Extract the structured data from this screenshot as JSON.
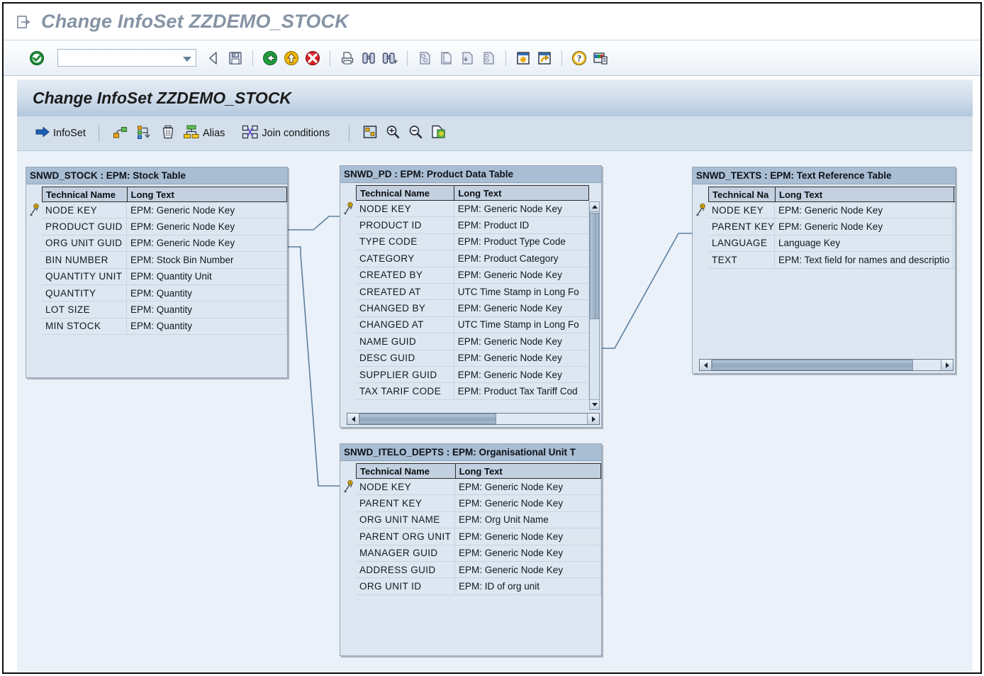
{
  "window": {
    "title": "Change InfoSet ZZDEMO_STOCK",
    "title_icon": "exit-arrow-icon"
  },
  "system_toolbar": {
    "enter_icon": "enter-check-icon",
    "command_field": {
      "value": "",
      "placeholder": ""
    },
    "buttons": [
      {
        "name": "back-triangle-button",
        "icon": "back-triangle-icon"
      },
      {
        "name": "save-button",
        "icon": "save-disk-icon"
      },
      {
        "name": "back-button",
        "icon": "green-back-arrow-icon"
      },
      {
        "name": "exit-button",
        "icon": "yellow-exit-arrow-icon"
      },
      {
        "name": "cancel-button",
        "icon": "red-cancel-icon"
      },
      {
        "name": "print-button",
        "icon": "printer-icon"
      },
      {
        "name": "find-button",
        "icon": "binoculars-icon"
      },
      {
        "name": "find-next-button",
        "icon": "binoculars-plus-icon"
      },
      {
        "name": "first-page-button",
        "icon": "first-page-icon"
      },
      {
        "name": "previous-page-button",
        "icon": "previous-page-icon"
      },
      {
        "name": "next-page-button",
        "icon": "next-page-icon"
      },
      {
        "name": "last-page-button",
        "icon": "last-page-icon"
      },
      {
        "name": "new-session-button",
        "icon": "new-session-icon"
      },
      {
        "name": "create-shortcut-button",
        "icon": "shortcut-arrow-icon"
      },
      {
        "name": "help-button",
        "icon": "help-question-icon"
      },
      {
        "name": "customize-layout-button",
        "icon": "layout-menu-icon"
      }
    ]
  },
  "screen": {
    "title": "Change InfoSet ZZDEMO_STOCK"
  },
  "app_toolbar": {
    "items": [
      {
        "name": "infoset-button",
        "label": "InfoSet",
        "icon": "blue-right-arrow-icon"
      },
      {
        "name": "insert-table-button",
        "label": "",
        "icon": "insert-node-icon"
      },
      {
        "name": "arrange-button",
        "label": "",
        "icon": "arrange-nodes-icon"
      },
      {
        "name": "delete-button",
        "label": "",
        "icon": "trash-can-icon"
      },
      {
        "name": "alias-button",
        "label": "Alias",
        "icon": "alias-hierarchy-icon"
      },
      {
        "name": "join-conditions-button",
        "label": "Join conditions",
        "icon": "join-links-icon"
      },
      {
        "name": "overview-button",
        "label": "",
        "icon": "overview-map-icon"
      },
      {
        "name": "zoom-in-button",
        "label": "",
        "icon": "zoom-in-magnifier-icon"
      },
      {
        "name": "zoom-out-button",
        "label": "",
        "icon": "zoom-out-magnifier-icon"
      },
      {
        "name": "export-button",
        "label": "",
        "icon": "export-page-icon"
      }
    ]
  },
  "diagram": {
    "column_headers": {
      "technical_name": "Technical Name",
      "long_text": "Long Text"
    },
    "column_headers_truncated": {
      "technical_name": "Technical Na",
      "long_text": "Long Text"
    },
    "tables": [
      {
        "id": "snwd_stock",
        "title": "SNWD_STOCK : EPM: Stock Table",
        "key_row_index": 0,
        "rows": [
          {
            "technical_name": "NODE KEY",
            "long_text": "EPM: Generic Node Key"
          },
          {
            "technical_name": "PRODUCT GUID",
            "long_text": "EPM: Generic Node Key"
          },
          {
            "technical_name": "ORG UNIT GUID",
            "long_text": "EPM: Generic Node Key"
          },
          {
            "technical_name": "BIN NUMBER",
            "long_text": "EPM: Stock Bin Number"
          },
          {
            "technical_name": "QUANTITY UNIT",
            "long_text": "EPM: Quantity Unit"
          },
          {
            "technical_name": "QUANTITY",
            "long_text": "EPM: Quantity"
          },
          {
            "technical_name": "LOT SIZE",
            "long_text": "EPM: Quantity"
          },
          {
            "technical_name": "MIN STOCK",
            "long_text": "EPM: Quantity"
          }
        ]
      },
      {
        "id": "snwd_pd",
        "title": "SNWD_PD : EPM: Product Data Table",
        "key_row_index": 0,
        "rows": [
          {
            "technical_name": "NODE KEY",
            "long_text": "EPM: Generic Node Key"
          },
          {
            "technical_name": "PRODUCT ID",
            "long_text": "EPM: Product ID"
          },
          {
            "technical_name": "TYPE CODE",
            "long_text": "EPM: Product Type Code"
          },
          {
            "technical_name": "CATEGORY",
            "long_text": "EPM: Product Category"
          },
          {
            "technical_name": "CREATED BY",
            "long_text": "EPM: Generic Node Key"
          },
          {
            "technical_name": "CREATED AT",
            "long_text": "UTC Time Stamp in Long Fo"
          },
          {
            "technical_name": "CHANGED BY",
            "long_text": "EPM: Generic Node Key"
          },
          {
            "technical_name": "CHANGED AT",
            "long_text": "UTC Time Stamp in Long Fo"
          },
          {
            "technical_name": "NAME GUID",
            "long_text": "EPM: Generic Node Key"
          },
          {
            "technical_name": "DESC GUID",
            "long_text": "EPM: Generic Node Key"
          },
          {
            "technical_name": "SUPPLIER GUID",
            "long_text": "EPM: Generic Node Key"
          },
          {
            "technical_name": "TAX TARIF CODE",
            "long_text": "EPM: Product Tax Tariff Cod"
          }
        ]
      },
      {
        "id": "snwd_texts",
        "title": "SNWD_TEXTS : EPM: Text Reference Table",
        "key_row_index": 0,
        "rows": [
          {
            "technical_name": "NODE KEY",
            "long_text": "EPM: Generic Node Key"
          },
          {
            "technical_name": "PARENT KEY",
            "long_text": "EPM: Generic Node Key"
          },
          {
            "technical_name": "LANGUAGE",
            "long_text": "Language Key"
          },
          {
            "technical_name": "TEXT",
            "long_text": "EPM: Text field for names and descriptio"
          }
        ]
      },
      {
        "id": "snwd_itelo_depts",
        "title": "SNWD_ITELO_DEPTS : EPM: Organisational Unit T",
        "key_row_index": 0,
        "rows": [
          {
            "technical_name": "NODE KEY",
            "long_text": "EPM: Generic Node Key"
          },
          {
            "technical_name": "PARENT KEY",
            "long_text": "EPM: Generic Node Key"
          },
          {
            "technical_name": "ORG UNIT NAME",
            "long_text": "EPM: Org Unit Name"
          },
          {
            "technical_name": "PARENT ORG UNIT",
            "long_text": "EPM: Generic Node Key"
          },
          {
            "technical_name": "MANAGER GUID",
            "long_text": "EPM: Generic Node Key"
          },
          {
            "technical_name": "ADDRESS GUID",
            "long_text": "EPM: Generic Node Key"
          },
          {
            "technical_name": "ORG UNIT ID",
            "long_text": "EPM: ID of org unit"
          }
        ]
      }
    ],
    "join_lines": [
      {
        "name": "join-stock-to-pd"
      },
      {
        "name": "join-stock-to-depts"
      },
      {
        "name": "join-pd-to-texts"
      }
    ]
  },
  "colors": {
    "canvas_bg": "#eaf1f9",
    "node_bg": "#dde7f1",
    "node_title_bg": "#a9bdd3",
    "grid_header_bg": "#c2d0e0",
    "join_line": "#5b7f9e",
    "screen_band_top": "#e4ecf4",
    "screen_band_bottom": "#b3c7dd",
    "app_toolbar_bg": "#d3dfea",
    "title_text": "#8593a5"
  }
}
